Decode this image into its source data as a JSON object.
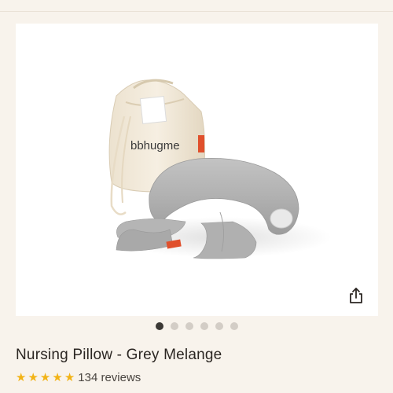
{
  "product": {
    "title": "Nursing Pillow - Grey Melange",
    "image_brand": "bbhugme",
    "image_alt": "Grey nursing pillow with canvas drawstring bag",
    "share_icon": "share-icon"
  },
  "carousel": {
    "slide_count": 6,
    "active_index": 0
  },
  "rating": {
    "stars": 5,
    "reviews_label": "134 reviews"
  },
  "colors": {
    "star": "#f2b316",
    "active_dot": "#3b3835",
    "inactive_dot": "#d3cdc6",
    "tag": "#e0502c"
  }
}
